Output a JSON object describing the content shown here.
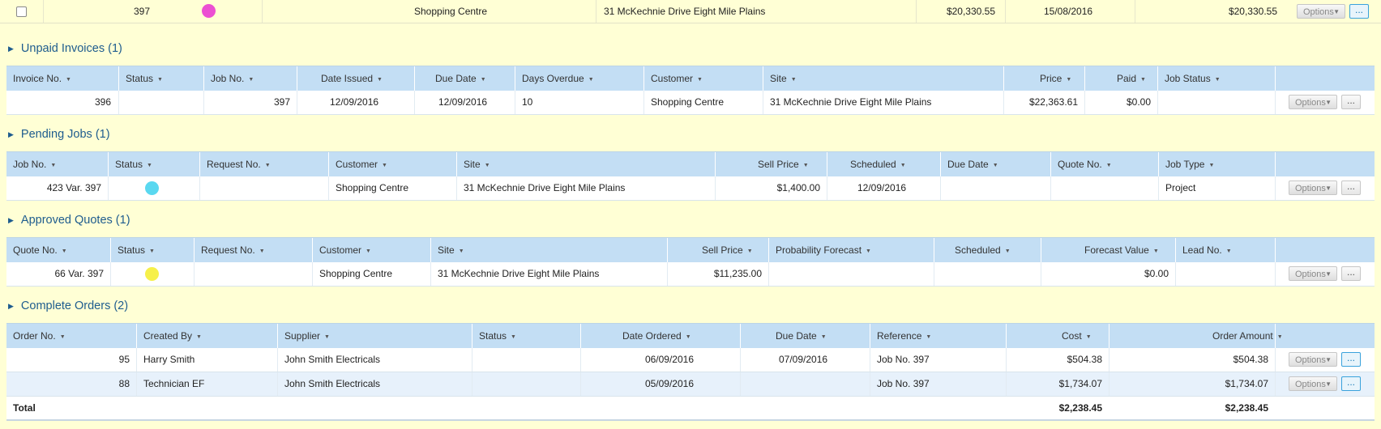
{
  "top_row": {
    "job_no": "397",
    "status_color": "#ec4fd2",
    "customer": "Shopping Centre",
    "site": "31 McKechnie Drive Eight Mile Plains",
    "amount": "$20,330.55",
    "date": "15/08/2016",
    "amount2": "$20,330.55",
    "options_label": "Options",
    "more_label": "..."
  },
  "sections": {
    "unpaid": {
      "title": "Unpaid Invoices (1)",
      "headers": [
        "Invoice No.",
        "Status",
        "Job No.",
        "Date Issued",
        "Due Date",
        "Days Overdue",
        "Customer",
        "Site",
        "Price",
        "Paid",
        "Job Status"
      ],
      "rows": [
        {
          "invoice_no": "396",
          "job_no": "397",
          "date_issued": "12/09/2016",
          "due_date": "12/09/2016",
          "days_overdue": "10",
          "customer": "Shopping Centre",
          "site": "31 McKechnie Drive Eight Mile Plains",
          "price": "$22,363.61",
          "paid": "$0.00"
        }
      ]
    },
    "pending": {
      "title": "Pending Jobs (1)",
      "headers": [
        "Job No.",
        "Status",
        "Request No.",
        "Customer",
        "Site",
        "Sell Price",
        "Scheduled",
        "Due Date",
        "Quote No.",
        "Job Type"
      ],
      "rows": [
        {
          "job_no": "423 Var. 397",
          "status_color": "#5ad8f0",
          "customer": "Shopping Centre",
          "site": "31 McKechnie Drive Eight Mile Plains",
          "sell_price": "$1,400.00",
          "scheduled": "12/09/2016",
          "job_type": "Project"
        }
      ]
    },
    "quotes": {
      "title": "Approved Quotes (1)",
      "headers": [
        "Quote No.",
        "Status",
        "Request No.",
        "Customer",
        "Site",
        "Sell Price",
        "Probability Forecast",
        "Scheduled",
        "Forecast Value",
        "Lead No."
      ],
      "rows": [
        {
          "quote_no": "66 Var. 397",
          "status_color": "#f6f04a",
          "customer": "Shopping Centre",
          "site": "31 McKechnie Drive Eight Mile Plains",
          "sell_price": "$11,235.00",
          "forecast_value": "$0.00"
        }
      ]
    },
    "orders": {
      "title": "Complete Orders (2)",
      "headers": [
        "Order No.",
        "Created By",
        "Supplier",
        "Status",
        "Date Ordered",
        "Due Date",
        "Reference",
        "Cost",
        "Order Amount"
      ],
      "rows": [
        {
          "order_no": "95",
          "created_by": "Harry Smith",
          "supplier": "John Smith Electricals",
          "date_ordered": "06/09/2016",
          "due_date": "07/09/2016",
          "reference": "Job No. 397",
          "cost": "$504.38",
          "order_amount": "$504.38"
        },
        {
          "order_no": "88",
          "created_by": "Technician EF",
          "supplier": "John Smith Electricals",
          "date_ordered": "05/09/2016",
          "due_date": "",
          "reference": "Job No. 397",
          "cost": "$1,734.07",
          "order_amount": "$1,734.07"
        }
      ],
      "total_label": "Total",
      "total_cost": "$2,238.45",
      "total_amount": "$2,238.45"
    }
  },
  "buttons": {
    "options": "Options",
    "more": "..."
  },
  "colors": {
    "page_bg": "#ffffd5",
    "header_bg": "#c3def4",
    "section_title": "#1e5c8e",
    "alt_row": "#e7f1fb"
  }
}
